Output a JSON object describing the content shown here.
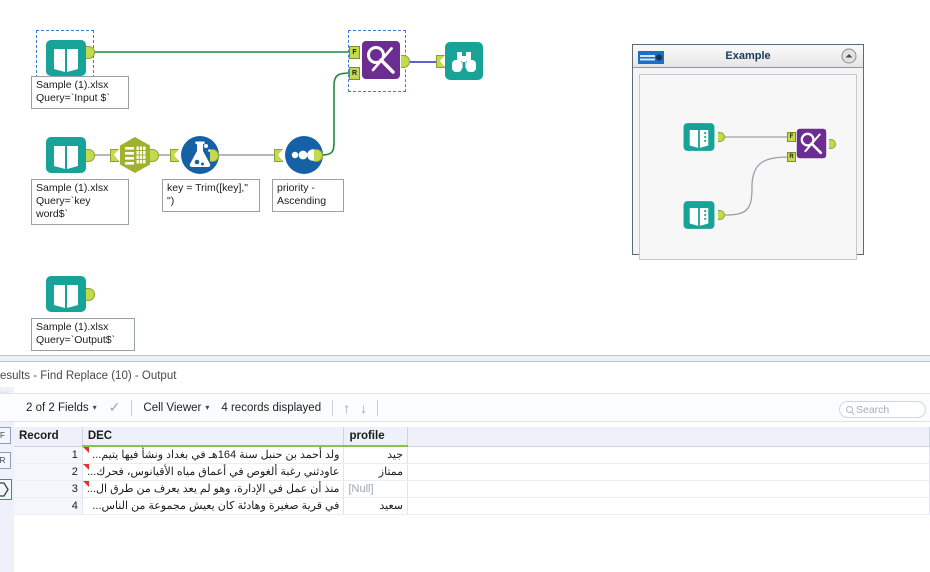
{
  "canvas": {
    "tools": [
      {
        "id": "input-1",
        "type": "input-data-tool",
        "icon": "book-icon",
        "annotation": "Sample (1).xlsx\nQuery=`Input $`",
        "selected": true
      },
      {
        "id": "input-2",
        "type": "input-data-tool",
        "icon": "book-icon",
        "annotation": "Sample (1).xlsx\nQuery=`key\nword$`",
        "selected": false
      },
      {
        "id": "select-1",
        "type": "select-tool",
        "icon": "select-hexagon-icon",
        "annotation": "",
        "selected": false
      },
      {
        "id": "formula-1",
        "type": "formula-tool",
        "icon": "flask-icon",
        "annotation": "key = Trim([key],\"\n\")",
        "selected": false
      },
      {
        "id": "sort-1",
        "type": "sort-tool",
        "icon": "sort-dots-icon",
        "annotation": "priority -\nAscending",
        "selected": false
      },
      {
        "id": "findreplace-1",
        "type": "find-replace-tool",
        "icon": "scissors-magnifier-icon",
        "annotation": "",
        "selected": true,
        "input_labels": [
          "F",
          "R"
        ]
      },
      {
        "id": "browse-1",
        "type": "browse-tool",
        "icon": "binoculars-icon",
        "annotation": "",
        "selected": false
      },
      {
        "id": "input-3",
        "type": "input-data-tool",
        "icon": "book-icon",
        "annotation": "Sample (1).xlsx\nQuery=`Output$`",
        "selected": false
      }
    ],
    "colors": {
      "input_teal": "#17a398",
      "select_olive": "#9fb22e",
      "formula_blue": "#1462a5",
      "sort_blue": "#1462a5",
      "findreplace_purple": "#6b2d8f",
      "browse_teal": "#17a398",
      "wire_green": "#1f8a3d",
      "wire_blue": "#2b2bc8",
      "wire_gray": "#9aa0a6",
      "selection_blue": "#3a7fd5",
      "anchor_green": "#c3d94e"
    }
  },
  "example_panel": {
    "title": "Example",
    "header_icon": "workflow-thumb-icon",
    "collapse_icon": "collapse-chevron-up-icon",
    "tools": [
      {
        "id": "ex-input-1",
        "icon": "book-icon"
      },
      {
        "id": "ex-input-2",
        "icon": "book-icon"
      },
      {
        "id": "ex-findreplace",
        "icon": "scissors-magnifier-icon",
        "input_labels": [
          "F",
          "R"
        ]
      }
    ]
  },
  "results": {
    "title": "esults - Find Replace (10) - Output",
    "toolbar": {
      "fields_label": "2 of 2 Fields",
      "fields_caret": "▾",
      "check_icon": "check-icon",
      "view_label": "Cell Viewer",
      "view_caret": "▾",
      "records_label": "4 records displayed",
      "up_icon": "↑",
      "down_icon": "↓"
    },
    "search": {
      "placeholder": "Search",
      "icon": "search-icon"
    },
    "rail_buttons": [
      "F",
      "R"
    ],
    "columns": [
      "Record",
      "DEC",
      "profile"
    ],
    "rows": [
      {
        "record": "1",
        "dec": "ولد أحمد بن حنبل سنة 164هـ في بغداد ونشأ فيها يتيم...",
        "truncated": true,
        "profile": "جيد",
        "profile_null": false
      },
      {
        "record": "2",
        "dec": "عاودثني رغبة ألغوص في أعماق مياه الأقيانوس، فحرك...",
        "truncated": true,
        "profile": "ممتاز",
        "profile_null": false
      },
      {
        "record": "3",
        "dec": "منذ أن عمل في الإدارة، وهو لم يعد يعرف من طرق ال...",
        "truncated": true,
        "profile": "[Null]",
        "profile_null": true
      },
      {
        "record": "4",
        "dec": "في قرية صغيرة وهادئة كان يعيش مجموعة من الناس...",
        "truncated": false,
        "profile": "سعيد",
        "profile_null": false
      }
    ]
  }
}
